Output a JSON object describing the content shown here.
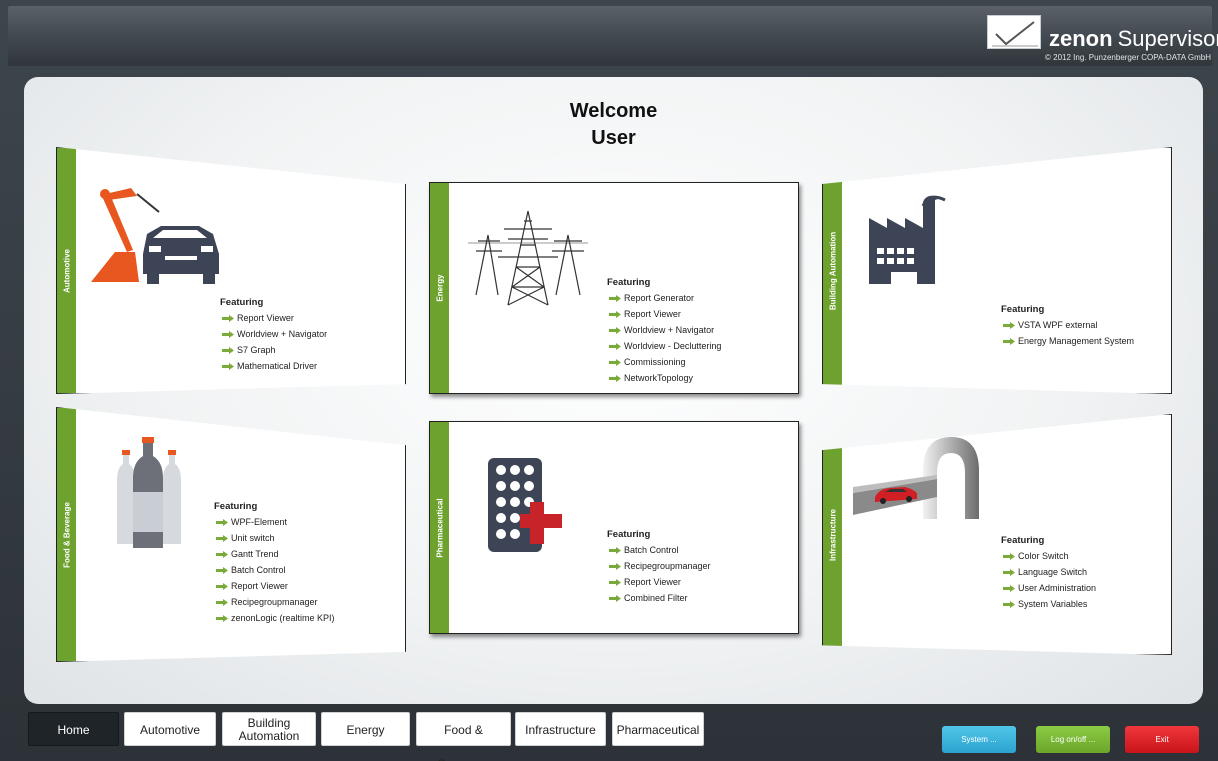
{
  "header": {
    "brand_bold": "zenon",
    "brand_rest": "Supervisor",
    "copyright": "© 2012 Ing. Punzenberger COPA-DATA GmbH"
  },
  "main": {
    "welcome_line1": "Welcome",
    "welcome_line2": "User"
  },
  "cards": {
    "automotive": {
      "label": "Automotive",
      "featuring": "Featuring",
      "items": [
        "Report Viewer",
        "Worldview + Navigator",
        "S7 Graph",
        "Mathematical Driver"
      ]
    },
    "energy": {
      "label": "Energy",
      "featuring": "Featuring",
      "items": [
        "Report Generator",
        "Report Viewer",
        "Worldview + Navigator",
        "Worldview - Decluttering",
        "Commissioning",
        "NetworkTopology"
      ]
    },
    "building": {
      "label": "Building Automation",
      "featuring": "Featuring",
      "items": [
        "VSTA WPF external",
        "Energy Management System"
      ]
    },
    "food": {
      "label": "Food & Beverage",
      "featuring": "Featuring",
      "items": [
        "WPF-Element",
        "Unit switch",
        "Gantt Trend",
        "Batch Control",
        "Report Viewer",
        "Recipegroupmanager",
        "zenonLogic (realtime KPI)"
      ]
    },
    "pharma": {
      "label": "Pharmaceutical",
      "featuring": "Featuring",
      "items": [
        "Batch Control",
        "Recipegroupmanager",
        "Report Viewer",
        "Combined Filter"
      ]
    },
    "infra": {
      "label": "Infrastructure",
      "featuring": "Featuring",
      "items": [
        "Color Switch",
        "Language Switch",
        "User Administration",
        "System Variables"
      ]
    }
  },
  "nav": {
    "tabs": {
      "home": "Home",
      "automotive": "Automotive",
      "building_line1": "Building",
      "building_line2": "Automation",
      "energy": "Energy",
      "food": "Food & Beverage",
      "infrastructure": "Infrastructure",
      "pharmaceutical": "Pharmaceutical"
    },
    "buttons": {
      "system": "System ...",
      "log": "Log on/off ...",
      "exit": "Exit"
    }
  },
  "colors": {
    "accent_green": "#6ea22f",
    "arrow_green": "#7aab3a",
    "system_blue": "#3db7e2",
    "log_green": "#7cbd38",
    "exit_red": "#e0262b"
  },
  "icons": {
    "automotive": "robot-arm-car-icon",
    "energy": "power-pylon-icon",
    "building": "factory-icon",
    "food": "bottles-icon",
    "pharma": "pill-pack-icon",
    "infra": "tunnel-car-icon"
  }
}
